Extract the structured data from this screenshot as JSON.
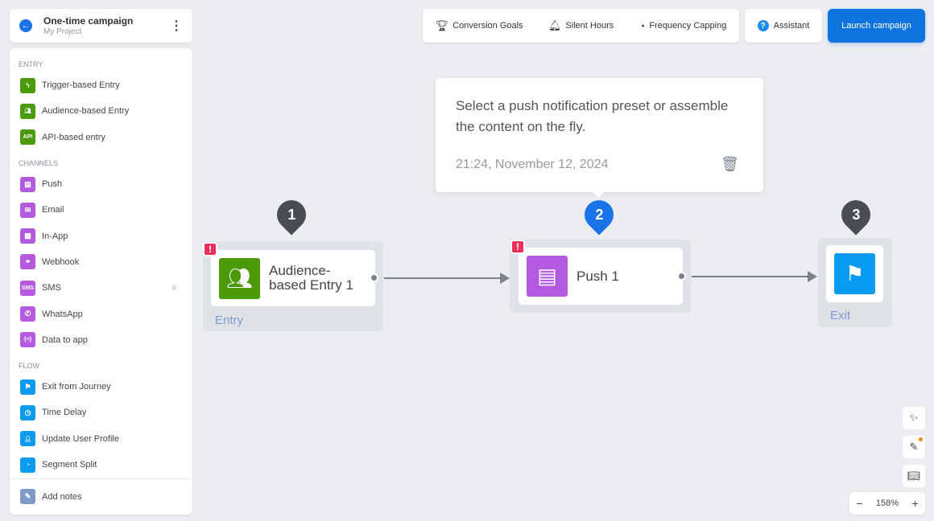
{
  "header": {
    "title": "One-time campaign",
    "subtitle": "My Project"
  },
  "sidebar": {
    "sections": [
      {
        "title": "ENTRY",
        "items": [
          {
            "label": "Trigger-based Entry",
            "icon": "bolt-icon"
          },
          {
            "label": "Audience-based Entry",
            "icon": "users-icon"
          },
          {
            "label": "API-based entry",
            "icon": "api-icon"
          }
        ]
      },
      {
        "title": "CHANNELS",
        "items": [
          {
            "label": "Push",
            "icon": "push-icon"
          },
          {
            "label": "Email",
            "icon": "email-icon"
          },
          {
            "label": "In-App",
            "icon": "inapp-icon"
          },
          {
            "label": "Webhook",
            "icon": "webhook-icon"
          },
          {
            "label": "SMS",
            "icon": "sms-icon",
            "premium": true
          },
          {
            "label": "WhatsApp",
            "icon": "whatsapp-icon"
          },
          {
            "label": "Data to app",
            "icon": "data-icon"
          }
        ]
      },
      {
        "title": "FLOW",
        "items": [
          {
            "label": "Exit from Journey",
            "icon": "flag-icon"
          },
          {
            "label": "Time Delay",
            "icon": "clock-icon"
          },
          {
            "label": "Update User Profile",
            "icon": "profile-icon"
          },
          {
            "label": "Segment Split",
            "icon": "split-icon"
          }
        ]
      }
    ],
    "footer": "Add notes"
  },
  "toolbar": {
    "conversion": "Conversion Goals",
    "silent": "Silent Hours",
    "frequency": "Frequency Capping",
    "assistant": "Assistant",
    "launch": "Launch campaign"
  },
  "popup": {
    "message": "Select a push notification preset or assemble the content on the fly.",
    "date": "21:24, November 12, 2024"
  },
  "nodes": [
    {
      "step": "1",
      "title": "Audience-based Entry 1",
      "group": "Entry",
      "error": true
    },
    {
      "step": "2",
      "title": "Push 1",
      "group": "",
      "error": true
    },
    {
      "step": "3",
      "title": "",
      "group": "Exit",
      "error": false
    }
  ],
  "colors": {
    "entry": "#4a9a0a",
    "channel": "#b45ae0",
    "flow": "#0a9bf0",
    "accent": "#0f74e0",
    "error": "#e8305a"
  },
  "zoom": {
    "level": "158%",
    "minus": "−",
    "plus": "+"
  }
}
